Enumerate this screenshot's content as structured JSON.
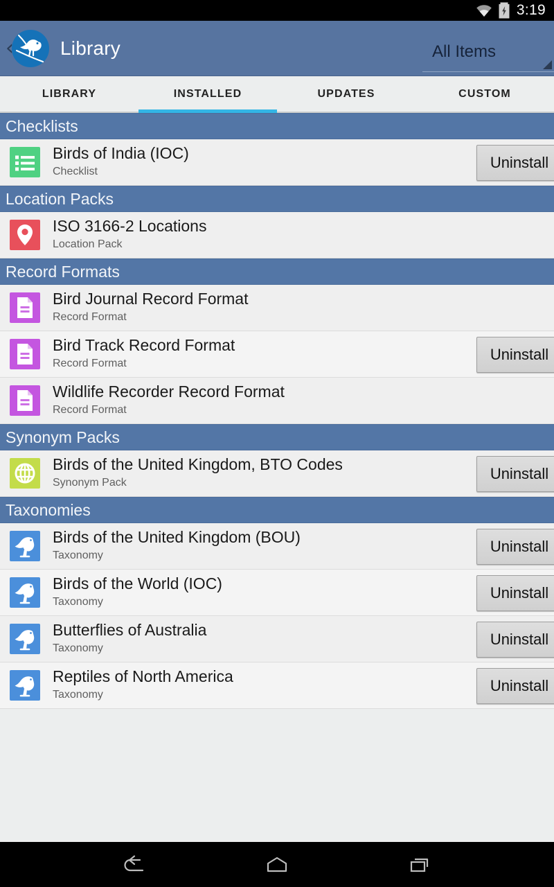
{
  "status_bar": {
    "time": "3:19",
    "wifi_icon": "wifi-icon",
    "battery_icon": "battery-charging-icon"
  },
  "action_bar": {
    "back_icon": "back-chevron-icon",
    "logo_icon": "bird-logo-icon",
    "title": "Library",
    "spinner": {
      "selected": "All Items",
      "caret_icon": "dropdown-caret-icon"
    }
  },
  "tabs": [
    {
      "label": "LIBRARY",
      "active": false
    },
    {
      "label": "INSTALLED",
      "active": true
    },
    {
      "label": "UPDATES",
      "active": false
    },
    {
      "label": "CUSTOM",
      "active": false
    }
  ],
  "colors": {
    "action_bar": "#5774a0",
    "section_header": "#5376a6",
    "tab_indicator": "#33b5e5",
    "list_background": "#efefef",
    "icon_checklist": "#4fd182",
    "icon_location": "#e8505b",
    "icon_record_format": "#c456e0",
    "icon_synonym": "#c3dc4a",
    "icon_taxonomy": "#4b8fdb"
  },
  "buttons": {
    "uninstall_label": "Uninstall"
  },
  "sections": [
    {
      "title": "Checklists",
      "items": [
        {
          "title": "Birds of India (IOC)",
          "subtitle": "Checklist",
          "icon": "checklist-icon",
          "icon_color": "#4fd182",
          "has_uninstall": true
        }
      ]
    },
    {
      "title": "Location Packs",
      "items": [
        {
          "title": "ISO 3166-2 Locations",
          "subtitle": "Location Pack",
          "icon": "map-pin-icon",
          "icon_color": "#e8505b",
          "has_uninstall": false
        }
      ]
    },
    {
      "title": "Record Formats",
      "items": [
        {
          "title": "Bird Journal Record Format",
          "subtitle": "Record Format",
          "icon": "document-icon",
          "icon_color": "#c456e0",
          "has_uninstall": false
        },
        {
          "title": "Bird Track Record Format",
          "subtitle": "Record Format",
          "icon": "document-icon",
          "icon_color": "#c456e0",
          "has_uninstall": true
        },
        {
          "title": "Wildlife Recorder Record Format",
          "subtitle": "Record Format",
          "icon": "document-icon",
          "icon_color": "#c456e0",
          "has_uninstall": false
        }
      ]
    },
    {
      "title": "Synonym Packs",
      "items": [
        {
          "title": "Birds of the United Kingdom, BTO Codes",
          "subtitle": "Synonym Pack",
          "icon": "globe-icon",
          "icon_color": "#c3dc4a",
          "has_uninstall": true
        }
      ]
    },
    {
      "title": "Taxonomies",
      "items": [
        {
          "title": "Birds of the United Kingdom (BOU)",
          "subtitle": "Taxonomy",
          "icon": "bird-icon",
          "icon_color": "#4b8fdb",
          "has_uninstall": true
        },
        {
          "title": "Birds of the World (IOC)",
          "subtitle": "Taxonomy",
          "icon": "bird-icon",
          "icon_color": "#4b8fdb",
          "has_uninstall": true
        },
        {
          "title": "Butterflies of Australia",
          "subtitle": "Taxonomy",
          "icon": "bird-icon",
          "icon_color": "#4b8fdb",
          "has_uninstall": true
        },
        {
          "title": "Reptiles of North America",
          "subtitle": "Taxonomy",
          "icon": "bird-icon",
          "icon_color": "#4b8fdb",
          "has_uninstall": true
        }
      ]
    }
  ],
  "nav_bar": {
    "back": "back-icon",
    "home": "home-icon",
    "recents": "recents-icon"
  }
}
